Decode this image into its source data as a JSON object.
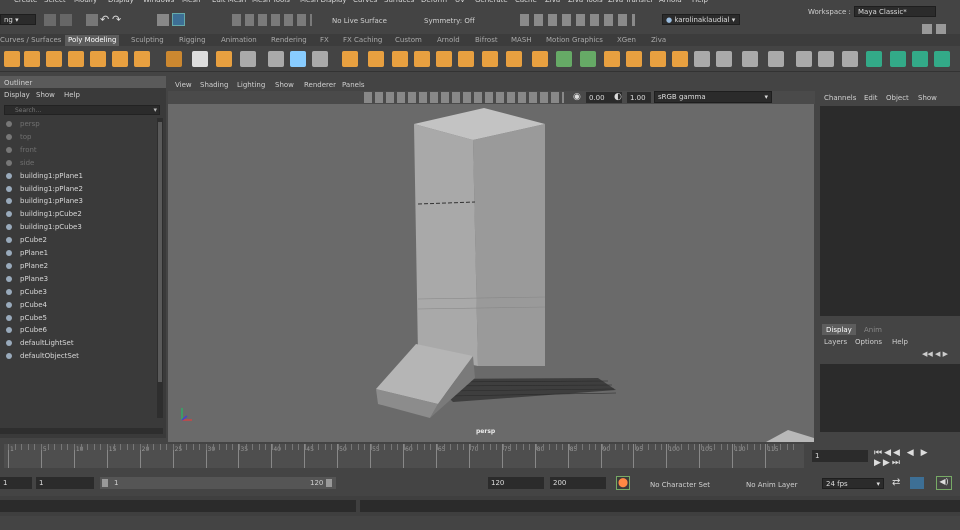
{
  "menubar": {
    "items": [
      "Create",
      "Select",
      "Modify",
      "Display",
      "Windows",
      "Mesh",
      "Edit Mesh",
      "Mesh Tools",
      "Mesh Display",
      "Curves",
      "Surfaces",
      "Deform",
      "UV",
      "Generate",
      "Cache",
      "Ziva",
      "Ziva Tools",
      "Ziva Transfer",
      "Arnold",
      "Help"
    ],
    "workspace_label": "Workspace :",
    "workspace_value": "Maya Classic*"
  },
  "status": {
    "mode": "ng",
    "live_surface": "No Live Surface",
    "symmetry": "Symmetry: Off",
    "user": "karolinaklaudial"
  },
  "shelf_tabs": [
    "Curves / Surfaces",
    "Poly Modeling",
    "Sculpting",
    "Rigging",
    "Animation",
    "Rendering",
    "FX",
    "FX Caching",
    "Custom",
    "Arnold",
    "Bifrost",
    "MASH",
    "Motion Graphics",
    "XGen",
    "Ziva"
  ],
  "shelf_active": 1,
  "outliner": {
    "title": "Outliner",
    "menu": [
      "Display",
      "Show",
      "Help"
    ],
    "search_placeholder": "Search...",
    "items": [
      {
        "label": "persp",
        "dim": true
      },
      {
        "label": "top",
        "dim": true
      },
      {
        "label": "front",
        "dim": true
      },
      {
        "label": "side",
        "dim": true
      },
      {
        "label": "building1:pPlane1",
        "dim": false
      },
      {
        "label": "building1:pPlane2",
        "dim": false
      },
      {
        "label": "building1:pPlane3",
        "dim": false
      },
      {
        "label": "building1:pCube2",
        "dim": false
      },
      {
        "label": "building1:pCube3",
        "dim": false
      },
      {
        "label": "pCube2",
        "dim": false
      },
      {
        "label": "pPlane1",
        "dim": false
      },
      {
        "label": "pPlane2",
        "dim": false
      },
      {
        "label": "pPlane3",
        "dim": false
      },
      {
        "label": "pCube3",
        "dim": false
      },
      {
        "label": "pCube4",
        "dim": false
      },
      {
        "label": "pCube5",
        "dim": false
      },
      {
        "label": "pCube6",
        "dim": false
      },
      {
        "label": "defaultLightSet",
        "dim": false
      },
      {
        "label": "defaultObjectSet",
        "dim": false
      }
    ]
  },
  "viewport": {
    "menu": [
      "View",
      "Shading",
      "Lighting",
      "Show",
      "Renderer",
      "Panels"
    ],
    "near": "0.00",
    "far": "1.00",
    "colorspace": "sRGB gamma",
    "camera_label": "persp"
  },
  "channel_box": {
    "menu": [
      "Channels",
      "Edit",
      "Object",
      "Show"
    ]
  },
  "layer_editor": {
    "tabs": [
      "Display",
      "Anim"
    ],
    "menu": [
      "Layers",
      "Options",
      "Help"
    ]
  },
  "timeline": {
    "ticks": [
      "1",
      "5",
      "10",
      "15",
      "20",
      "25",
      "30",
      "35",
      "40",
      "45",
      "50",
      "55",
      "60",
      "65",
      "70",
      "75",
      "80",
      "85",
      "90",
      "95",
      "100",
      "105",
      "110",
      "115"
    ],
    "current_frame": "1"
  },
  "range": {
    "start": "1",
    "inner_start": "1",
    "slider_start": "1",
    "slider_end": "120",
    "end": "120",
    "anim_end": "200",
    "character_set": "No Character Set",
    "anim_layer": "No Anim Layer",
    "fps": "24 fps"
  },
  "colors": {
    "active_tab": "#5d5d5d",
    "viewport_bg": "#6a6a6a",
    "panel_bg": "#444444",
    "building": "#a8a8a8"
  }
}
